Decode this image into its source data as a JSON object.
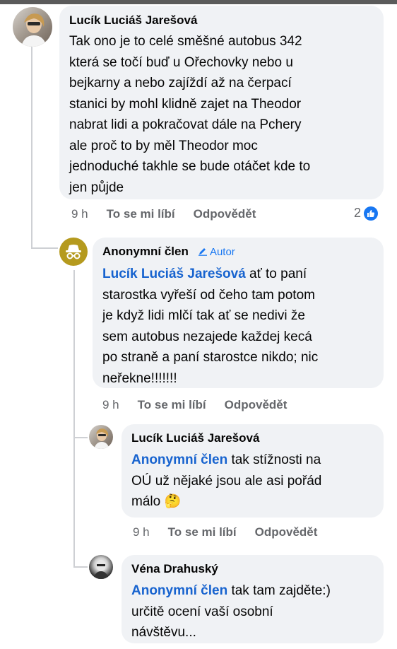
{
  "comments": [
    {
      "name": "Lucík Luciáš Jarešová",
      "text": "Tak ono je to celé směšné autobus 342\nkterá se točí buď u Ořechovky nebo u\nbejkarny a nebo zajíždí až na  čerpací\nstanici by mohl klidně zajet na Theodor\nnabrat lidi a pokračovat dále na Pchery\nale proč to by měl Theodor moc\njednoduché takhle se bude otáčet kde to\njen půjde",
      "time": "9 h",
      "like_label": "To se mi líbí",
      "reply_label": "Odpovědět",
      "reaction_count": "2"
    },
    {
      "name": "Anonymní člen",
      "author_badge": "Autor",
      "mention": "Lucík Luciáš Jarešová",
      "text": " ať to paní\nstarostka vyřeší od čeho tam potom\nje když lidi mlčí tak ať se nedivi že\nsem autobus nezajede každej kecá\npo straně a paní starostce nikdo; nic\nneřekne!!!!!!!",
      "time": "9 h",
      "like_label": "To se mi líbí",
      "reply_label": "Odpovědět"
    },
    {
      "name": "Lucík Luciáš Jarešová",
      "mention": "Anonymní člen",
      "text": " tak stížnosti na\nOÚ už nějaké jsou ale asi pořád\nmálo ",
      "emoji": "🤔",
      "time": "9 h",
      "like_label": "To se mi líbí",
      "reply_label": "Odpovědět"
    },
    {
      "name": "Véna Drahuský",
      "mention": "Anonymní člen",
      "text": " tak tam zajděte:)\nurčitě ocení vaší osobní\nnávštěvu..."
    }
  ],
  "colors": {
    "bubble": "#f0f2f5",
    "mention": "#1763cf",
    "meta": "#65676b",
    "like_blue": "#1877f2",
    "anon_avatar": "#b59a1e"
  },
  "icons": [
    "avatar-photo",
    "anonymous-member-icon",
    "pencil-icon",
    "like-thumb-icon",
    "thinking-face-emoji"
  ]
}
